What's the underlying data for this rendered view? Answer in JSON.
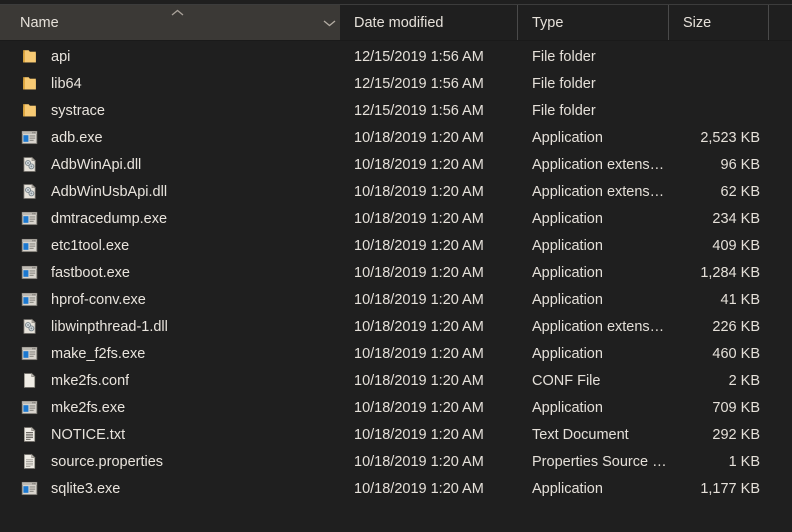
{
  "header": {
    "sort_indicator_icon": "sort-ascending-caret-icon",
    "dropdown_icon": "chevron-down-icon",
    "columns": [
      {
        "label": "Name",
        "key": "name"
      },
      {
        "label": "Date modified",
        "key": "date"
      },
      {
        "label": "Type",
        "key": "type"
      },
      {
        "label": "Size",
        "key": "size"
      }
    ]
  },
  "rows": [
    {
      "name": "api",
      "icon": "folder-icon",
      "date": "12/15/2019 1:56 AM",
      "type": "File folder",
      "size": ""
    },
    {
      "name": "lib64",
      "icon": "folder-icon",
      "date": "12/15/2019 1:56 AM",
      "type": "File folder",
      "size": ""
    },
    {
      "name": "systrace",
      "icon": "folder-icon",
      "date": "12/15/2019 1:56 AM",
      "type": "File folder",
      "size": ""
    },
    {
      "name": "adb.exe",
      "icon": "application-exe-icon",
      "date": "10/18/2019 1:20 AM",
      "type": "Application",
      "size": "2,523 KB"
    },
    {
      "name": "AdbWinApi.dll",
      "icon": "dll-library-icon",
      "date": "10/18/2019 1:20 AM",
      "type": "Application extens…",
      "size": "96 KB"
    },
    {
      "name": "AdbWinUsbApi.dll",
      "icon": "dll-library-icon",
      "date": "10/18/2019 1:20 AM",
      "type": "Application extens…",
      "size": "62 KB"
    },
    {
      "name": "dmtracedump.exe",
      "icon": "application-exe-icon",
      "date": "10/18/2019 1:20 AM",
      "type": "Application",
      "size": "234 KB"
    },
    {
      "name": "etc1tool.exe",
      "icon": "application-exe-icon",
      "date": "10/18/2019 1:20 AM",
      "type": "Application",
      "size": "409 KB"
    },
    {
      "name": "fastboot.exe",
      "icon": "application-exe-icon",
      "date": "10/18/2019 1:20 AM",
      "type": "Application",
      "size": "1,284 KB"
    },
    {
      "name": "hprof-conv.exe",
      "icon": "application-exe-icon",
      "date": "10/18/2019 1:20 AM",
      "type": "Application",
      "size": "41 KB"
    },
    {
      "name": "libwinpthread-1.dll",
      "icon": "dll-library-icon",
      "date": "10/18/2019 1:20 AM",
      "type": "Application extens…",
      "size": "226 KB"
    },
    {
      "name": "make_f2fs.exe",
      "icon": "application-exe-icon",
      "date": "10/18/2019 1:20 AM",
      "type": "Application",
      "size": "460 KB"
    },
    {
      "name": "mke2fs.conf",
      "icon": "blank-document-icon",
      "date": "10/18/2019 1:20 AM",
      "type": "CONF File",
      "size": "2 KB"
    },
    {
      "name": "mke2fs.exe",
      "icon": "application-exe-icon",
      "date": "10/18/2019 1:20 AM",
      "type": "Application",
      "size": "709 KB"
    },
    {
      "name": "NOTICE.txt",
      "icon": "text-document-icon",
      "date": "10/18/2019 1:20 AM",
      "type": "Text Document",
      "size": "292 KB"
    },
    {
      "name": "source.properties",
      "icon": "properties-document-icon",
      "date": "10/18/2019 1:20 AM",
      "type": "Properties Source …",
      "size": "1 KB"
    },
    {
      "name": "sqlite3.exe",
      "icon": "application-exe-icon",
      "date": "10/18/2019 1:20 AM",
      "type": "Application",
      "size": "1,177 KB"
    }
  ],
  "colors": {
    "background": "#1f1f1f",
    "header_active": "#3b3936",
    "text": "#e8e3dc",
    "folder_accent": "#f6c96b",
    "exe_accent": "#1b78d0"
  }
}
